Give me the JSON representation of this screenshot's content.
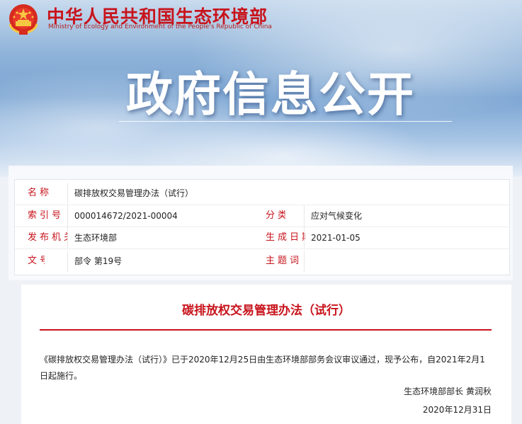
{
  "header": {
    "ministry_cn": "中华人民共和国生态环境部",
    "ministry_en": "Ministry of Ecology and Environment of the People's Republic of China",
    "emblem_icon": "national-emblem-icon",
    "banner_title": "政府信息公开"
  },
  "colors": {
    "brand_red": "#c8141c",
    "sky_blue": "#7aa4d2"
  },
  "meta": {
    "name_label": "名称",
    "name_value": "碳排放权交易管理办法（试行）",
    "index_label": "索引号",
    "index_value": "000014672/2021-00004",
    "category_label": "分类",
    "category_value": "应对气候变化",
    "publisher_label": "发布机关",
    "publisher_value": "生态环境部",
    "date_label": "生成日期",
    "date_value": "2021-01-05",
    "docno_label": "文号",
    "docno_value": "部令 第19号",
    "keywords_label": "主题词",
    "keywords_value": ""
  },
  "document": {
    "title": "碳排放权交易管理办法（试行）",
    "body": "《碳排放权交易管理办法（试行）》已于2020年12月25日由生态环境部部务会议审议通过，现予公布，自2021年2月1日起施行。",
    "signature": "生态环境部部长  黄润秋",
    "date": "2020年12月31日"
  }
}
